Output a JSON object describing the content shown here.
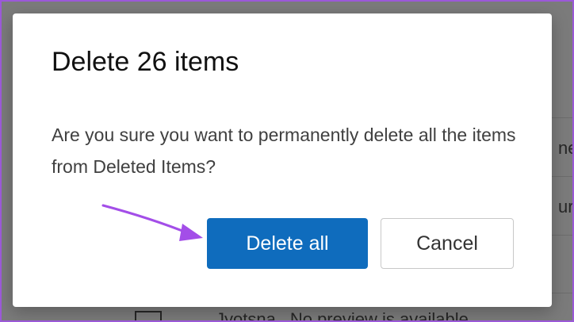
{
  "background": {
    "row_1_cut_text": "ne",
    "row_2_cut_text": "ur",
    "bottom_sender": "Jyotsna",
    "bottom_preview": "No preview is available."
  },
  "dialog": {
    "title": "Delete 26 items",
    "message": "Are you sure you want to permanently delete all the items from Deleted Items?",
    "confirm_label": "Delete all",
    "cancel_label": "Cancel"
  },
  "colors": {
    "primary_button": "#0f6cbd",
    "annotation_arrow": "#a34ee8",
    "frame": "#9b59d8"
  },
  "icons": {
    "annotation": "arrow-pointer-icon",
    "avatar": "contact-card-icon"
  }
}
